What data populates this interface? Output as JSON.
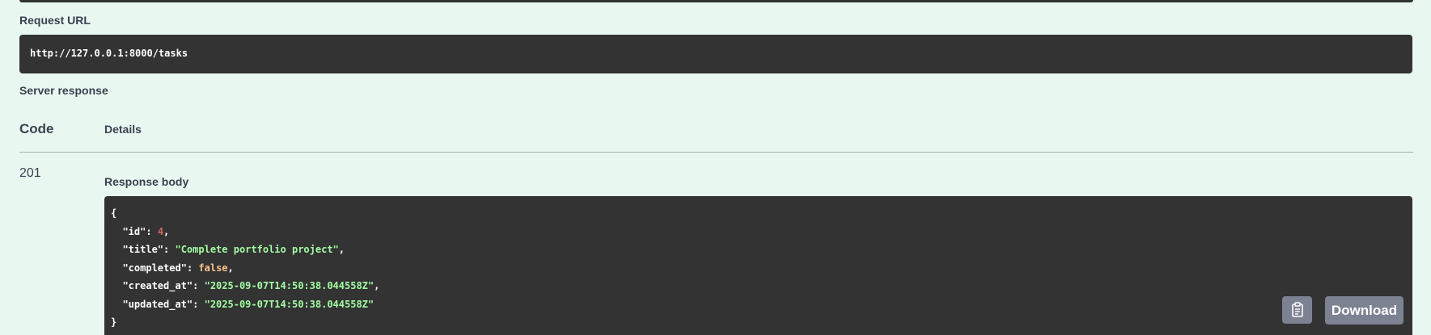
{
  "request_url": {
    "label": "Request URL",
    "value": "http://127.0.0.1:8000/tasks"
  },
  "server_response": {
    "label": "Server response",
    "columns": {
      "code": "Code",
      "details": "Details"
    },
    "status_code": "201",
    "response_body_label": "Response body",
    "body": {
      "open_brace": "{",
      "close_brace": "}",
      "fields": [
        {
          "key": "\"id\"",
          "value": "4",
          "type": "number",
          "sep": ","
        },
        {
          "key": "\"title\"",
          "value": "\"Complete portfolio project\"",
          "type": "string",
          "sep": ","
        },
        {
          "key": "\"completed\"",
          "value": "false",
          "type": "boolean",
          "sep": ","
        },
        {
          "key": "\"created_at\"",
          "value": "\"2025-09-07T14:50:38.044558Z\"",
          "type": "string",
          "sep": ","
        },
        {
          "key": "\"updated_at\"",
          "value": "\"2025-09-07T14:50:38.044558Z\"",
          "type": "string",
          "sep": ""
        }
      ]
    },
    "download_label": "Download",
    "copy_icon": "clipboard-copy-icon"
  },
  "colors": {
    "background": "#e8f8f1",
    "code_bg": "#333333",
    "json_string": "#a2fca2",
    "json_number": "#d36363",
    "json_boolean": "#fcc28c",
    "button_bg": "#7d8293"
  }
}
